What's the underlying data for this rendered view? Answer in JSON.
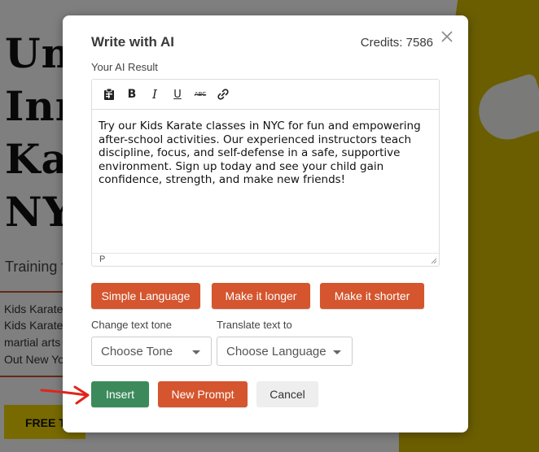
{
  "background": {
    "hero_lines": [
      "Un",
      "Inn",
      "Ka",
      "NY"
    ],
    "subtitle": "Training f",
    "paragraph_lines": [
      "Kids Karate",
      "Kids Karate",
      "martial arts",
      "Out New Yo"
    ],
    "cta_label": "FREE T"
  },
  "modal": {
    "title": "Write with AI",
    "credits": "Credits: 7586",
    "result_label": "Your AI Result",
    "editor": {
      "content": "Try our Kids Karate classes in NYC for fun and empowering after-school activities. Our experienced instructors teach discipline, focus, and self-defense in a safe, supportive environment. Sign up today and see your child gain confidence, strength, and make new friends!",
      "status_path": "P",
      "toolbar": {
        "bold": "B",
        "italic": "I",
        "underline": "U",
        "strikethrough": "ABC"
      }
    },
    "actions": {
      "simple_language": "Simple Language",
      "make_longer": "Make it longer",
      "make_shorter": "Make it shorter"
    },
    "tone": {
      "label": "Change text tone",
      "value": "Choose Tone"
    },
    "translate": {
      "label": "Translate text to",
      "value": "Choose Language"
    },
    "footer": {
      "insert": "Insert",
      "new_prompt": "New Prompt",
      "cancel": "Cancel"
    }
  },
  "colors": {
    "accent_orange": "#d4552e",
    "insert_green": "#3c8a5b",
    "annotation_red": "#e0251b"
  }
}
